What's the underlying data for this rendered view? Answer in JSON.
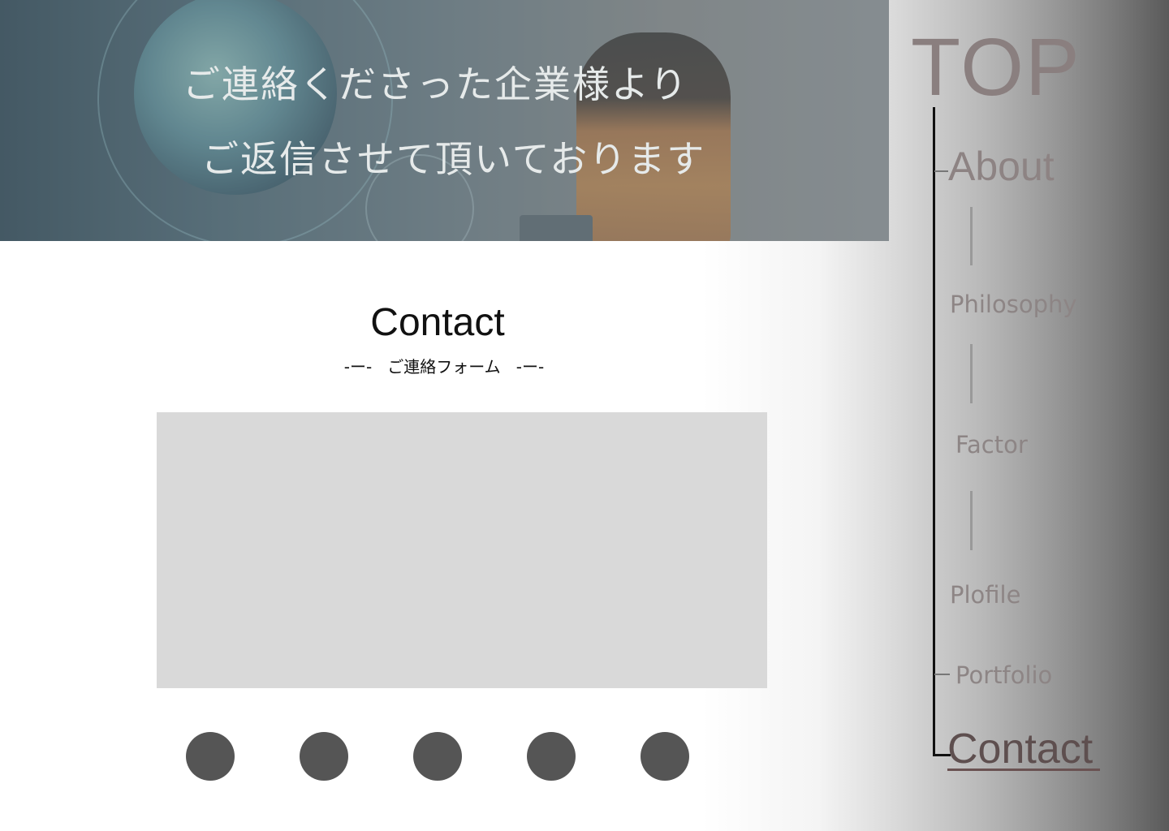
{
  "hero": {
    "line1": "ご連絡くださった企業様より",
    "line2": "ご返信させて頂いております"
  },
  "contact": {
    "title": "Contact",
    "subtitle": "-ー-   ご連絡フォーム   -ー-"
  },
  "nav": {
    "top": "TOP",
    "about": "About",
    "philosophy": "Philosophy",
    "factor": "Factor",
    "profile": "Plofile",
    "portfolio": "Portfolio",
    "contact": "Contact",
    "active": "Contact"
  },
  "colors": {
    "circle": "#555555",
    "form_box": "#d9d9d9"
  }
}
